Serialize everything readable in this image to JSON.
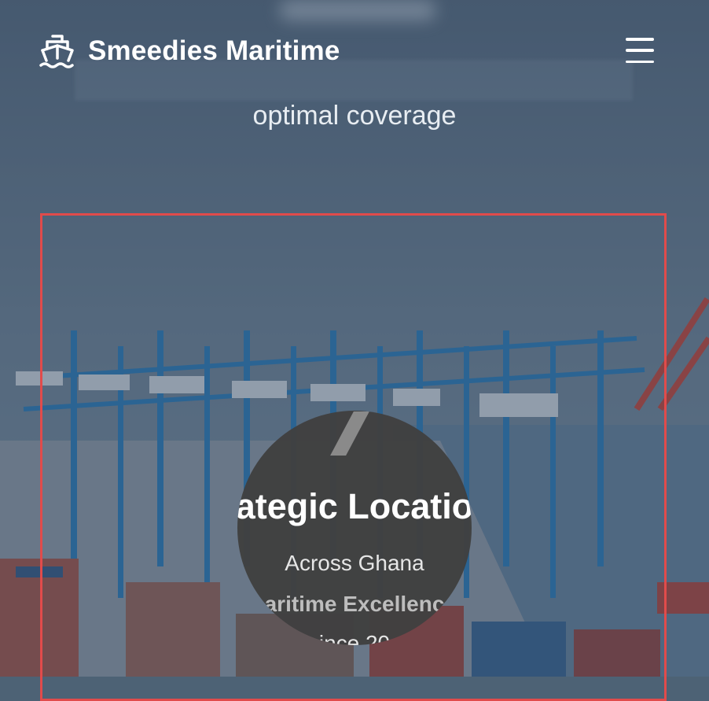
{
  "header": {
    "brand_name": "Smeedies Maritime",
    "logo_icon": "ship-icon",
    "menu_icon": "hamburger-menu-icon"
  },
  "hero": {
    "subtitle": "optimal coverage"
  },
  "feature_circle": {
    "title": "ategic Locatio",
    "line1": "Across Ghana",
    "line2": "aritime Excellenc",
    "line3": "ince 20"
  },
  "colors": {
    "frame": "#e14b4b",
    "circle": "#404040",
    "overlay": "#4d6275"
  }
}
